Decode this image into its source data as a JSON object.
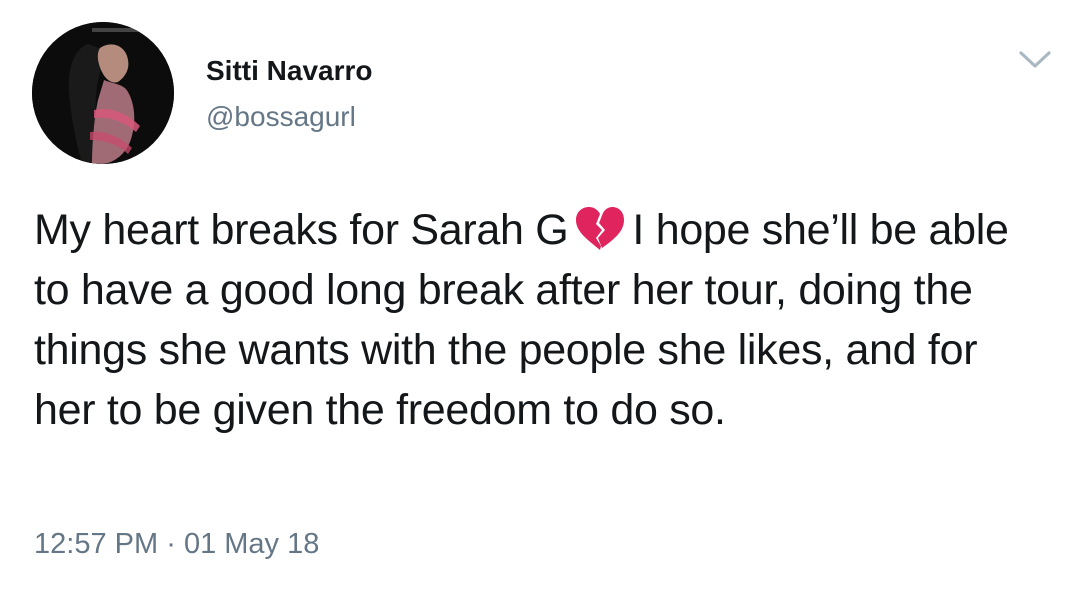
{
  "tweet": {
    "author": {
      "display_name": "Sitti Navarro",
      "handle": "@bossagurl",
      "avatar_icon": "profile-photo"
    },
    "menu_icon": "chevron-down-icon",
    "text_part1": "My heart breaks for Sarah G",
    "emoji": "broken-heart",
    "text_part2": "I hope she’ll be able to have a good long break after her tour, doing the things she wants with the people she likes, and for her to be given the freedom to do so.",
    "time": "12:57 PM",
    "separator": "·",
    "date": "01 May 18"
  },
  "colors": {
    "text": "#14171a",
    "secondary": "#657786",
    "chevron": "#aab8c2",
    "emoji": "#e0245e"
  }
}
